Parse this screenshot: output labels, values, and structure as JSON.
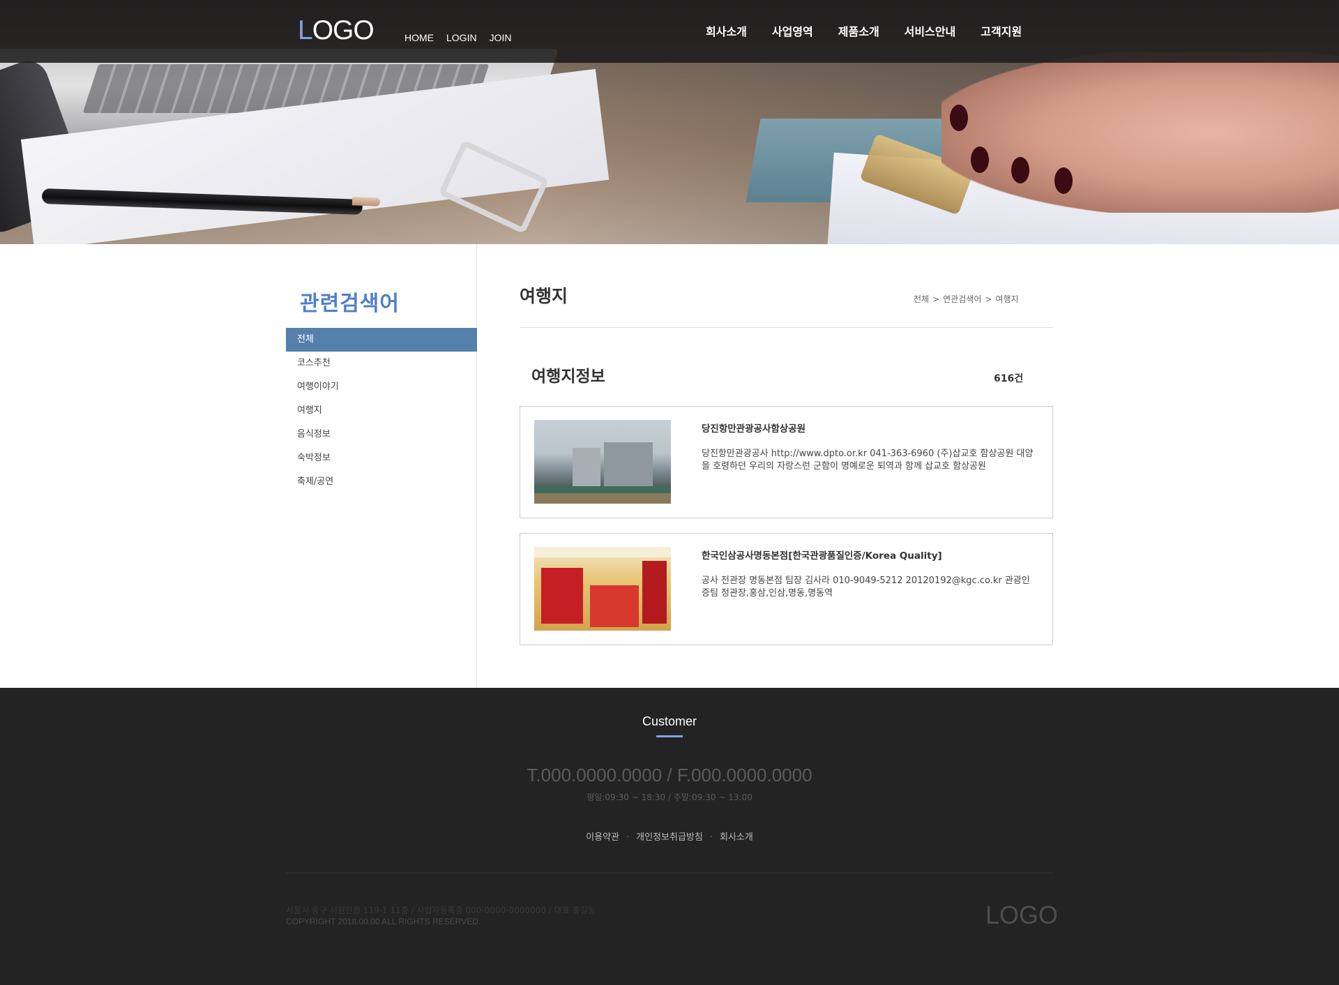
{
  "header": {
    "logo_first": "L",
    "logo_rest": "OGO",
    "util_nav": [
      "HOME",
      "LOGIN",
      "JOIN"
    ],
    "main_nav": [
      "회사소개",
      "사업영역",
      "제품소개",
      "서비스안내",
      "고객지원"
    ]
  },
  "sidebar": {
    "title": "관련검색어",
    "items": [
      {
        "label": "전체",
        "active": true
      },
      {
        "label": "코스추천"
      },
      {
        "label": "여행이야기"
      },
      {
        "label": "여행지"
      },
      {
        "label": "음식정보"
      },
      {
        "label": "숙박정보"
      },
      {
        "label": "축제/공연"
      }
    ]
  },
  "content": {
    "page_title": "여행지",
    "breadcrumb": [
      "전체",
      "연관검색어",
      "여행지"
    ],
    "breadcrumb_sep": ">",
    "section_title": "여행지정보",
    "count": "616건",
    "results": [
      {
        "title": "당진항만관광공사함상공원",
        "desc": " 당진항만관광공사 http://www.dpto.or.kr 041-363-6960 (주)삽교호 함상공원 대양을 호령하던 우리의 자랑스런 군함이 명예로운 퇴역과 함께 삽교호 함상공원",
        "thumb": "warship-park-photo"
      },
      {
        "title": "한국인삼공사명동본점[한국관광품질인증/Korea Quality]",
        "desc": " 공사 전관장 명동본점 팀장 김사라 010-9049-5212 20120192@kgc.co.kr 관광인증팀 정관장,홍삼,인삼,명동,명동역",
        "thumb": "ginseng-store-photo"
      }
    ]
  },
  "footer": {
    "title": "Customer",
    "phone": "T.000.0000.0000 / F.000.0000.0000",
    "hours": "평일:09:30 ~ 18:30 / 주말:09:30 ~ 13:00",
    "links": [
      "이용약관",
      "개인정보취급방침",
      "회사소개"
    ],
    "link_sep": "·",
    "address": "서울시 중구 서원인읍 119-1 11층 / 사업자등록증 000-0000-0000000 / 대표 홍길동",
    "copyright": "COPYRIGHT 2018.00.00 ALL RIGHTS RESERVED.",
    "logo": "LOGO"
  },
  "colors": {
    "accent": "#7fa3e0",
    "sidebar_title": "#4e7fc9",
    "active_item": "#5480ac",
    "footer_bg": "#232323"
  }
}
